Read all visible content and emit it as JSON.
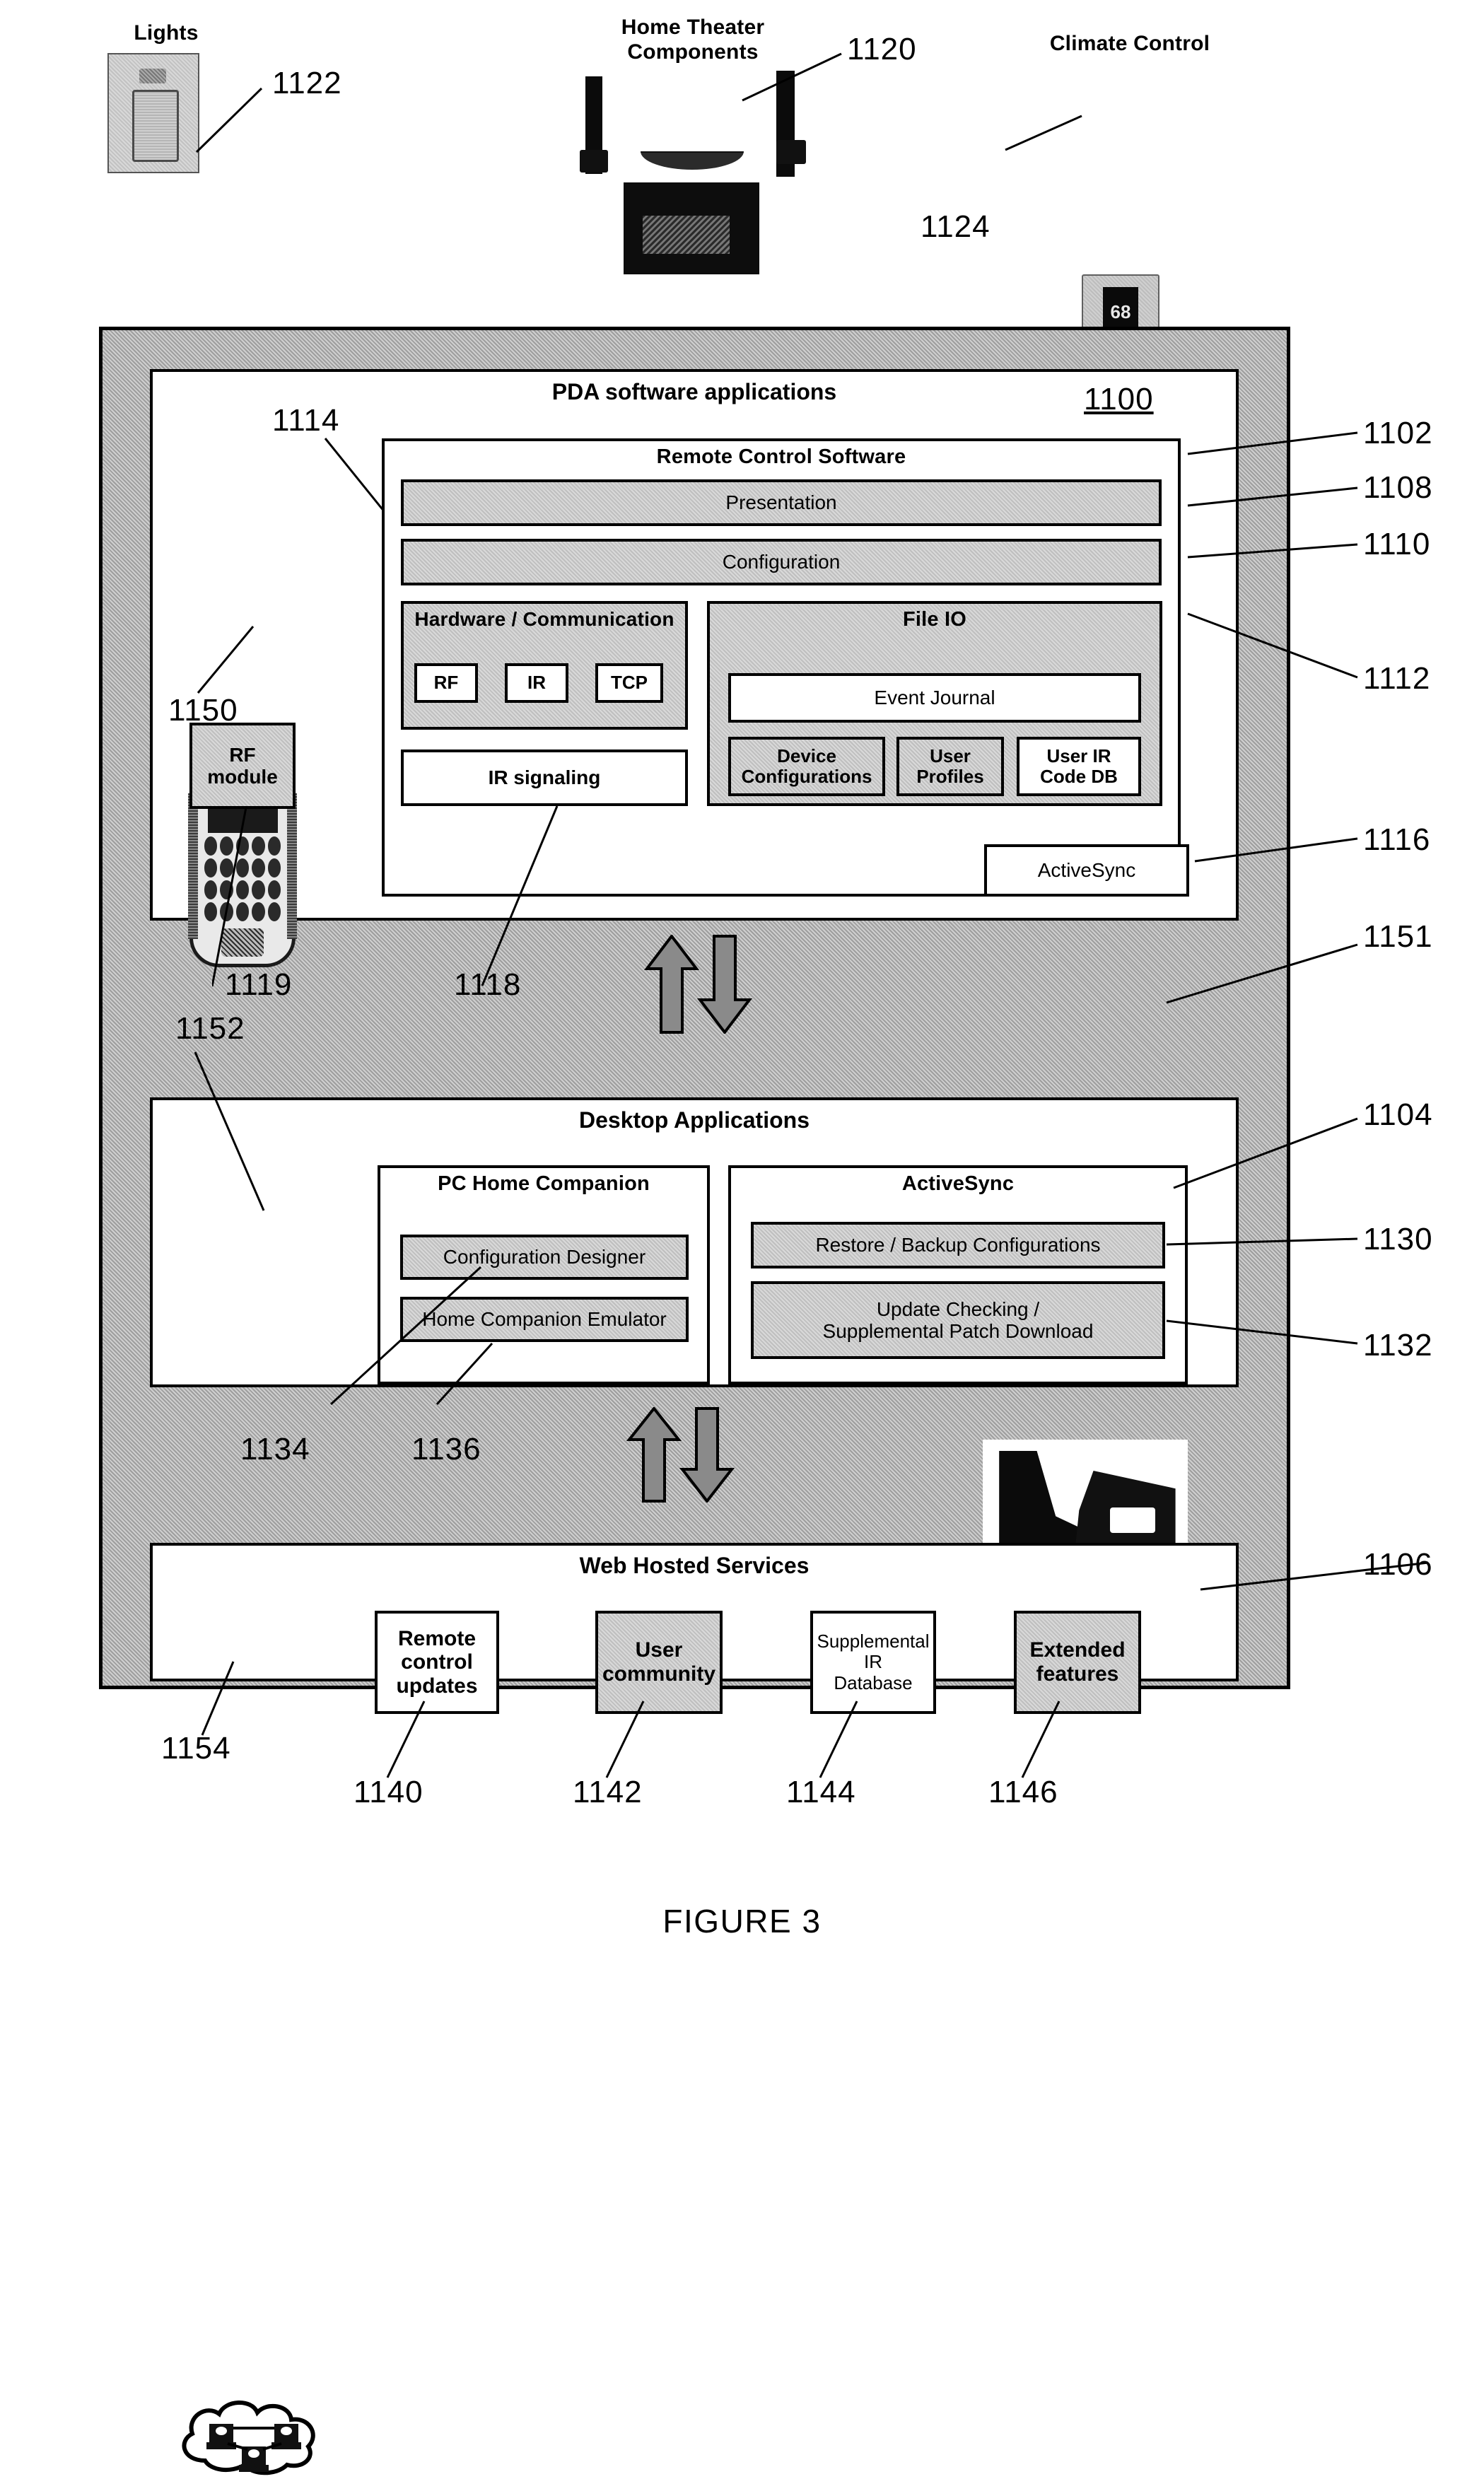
{
  "figure": {
    "caption": "FIGURE 3"
  },
  "devices": [
    {
      "label": "Lights",
      "ref": "1122"
    },
    {
      "label": "Home Theater\nComponents",
      "label_line1": "Home Theater",
      "label_line2": "Components",
      "ref": "1120"
    },
    {
      "label": "Climate Control",
      "ref": "1124",
      "display_value": "68"
    }
  ],
  "system": {
    "ref_main": "1100",
    "pda_panel": {
      "title": "PDA software applications",
      "ref": "1102",
      "pda_device_ref": "1150",
      "rf_module": {
        "label": "RF\nmodule",
        "line1": "RF",
        "line2": "module",
        "ref": "1119"
      },
      "ir_signaling": {
        "label": "IR signaling",
        "ref": "1118"
      },
      "hw_comm_ref": "1114",
      "activesync": {
        "label": "ActiveSync",
        "ref": "1116"
      },
      "remote_control_software": {
        "title": "Remote Control Software",
        "presentation": {
          "label": "Presentation",
          "ref": "1108"
        },
        "configuration": {
          "label": "Configuration",
          "ref": "1110"
        },
        "hardware_communication": {
          "title": "Hardware / Communication",
          "items": [
            "RF",
            "IR",
            "TCP"
          ]
        },
        "file_io": {
          "title": "File IO",
          "ref": "1112",
          "event_journal": "Event Journal",
          "items": [
            {
              "line1": "Device",
              "line2": "Configurations"
            },
            {
              "line1": "User",
              "line2": "Profiles"
            },
            {
              "line1": "User IR",
              "line2": "Code DB"
            }
          ]
        }
      }
    },
    "cradle": {
      "ref": "1151"
    },
    "desktop_panel": {
      "title": "Desktop Applications",
      "ref": "1104",
      "pc_ref": "1152",
      "pc_home_companion": {
        "title": "PC Home Companion",
        "items": [
          {
            "label": "Configuration Designer",
            "ref": "1134"
          },
          {
            "label": "Home Companion Emulator",
            "ref": "1136"
          }
        ]
      },
      "activesync": {
        "title": "ActiveSync",
        "items": [
          {
            "label": "Restore / Backup Configurations",
            "ref": "1130"
          },
          {
            "line1": "Update Checking /",
            "line2": "Supplemental Patch Download",
            "ref": "1132"
          }
        ]
      }
    },
    "web_panel": {
      "title": "Web Hosted Services",
      "ref": "1106",
      "cloud_ref": "1154",
      "services": [
        {
          "line1": "Remote",
          "line2": "control",
          "line3": "updates",
          "ref": "1140",
          "bold": true,
          "shaded": false
        },
        {
          "line1": "User",
          "line2": "community",
          "ref": "1142",
          "bold": true,
          "shaded": true
        },
        {
          "line1": "Supplemental IR",
          "line2": "Database",
          "ref": "1144",
          "bold": false,
          "shaded": false
        },
        {
          "line1": "Extended",
          "line2": "features",
          "ref": "1146",
          "bold": true,
          "shaded": true
        }
      ]
    }
  }
}
